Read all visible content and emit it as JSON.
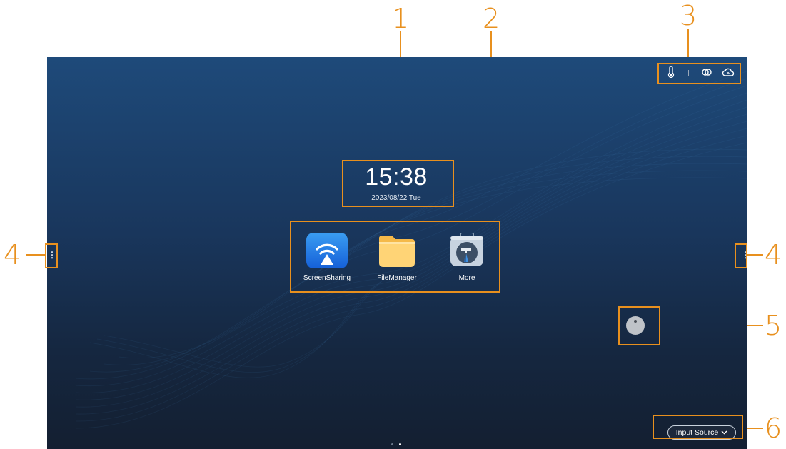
{
  "screen": {
    "clock": {
      "time": "15:38",
      "date": "2023/08/22 Tue"
    },
    "apps": [
      {
        "label": "ScreenSharing",
        "icon": "screen-sharing-icon"
      },
      {
        "label": "FileManager",
        "icon": "folder-icon"
      },
      {
        "label": "More",
        "icon": "toolbox-icon"
      }
    ],
    "status_bar": [
      "thermometer-icon",
      "link-icon",
      "cloud-icon"
    ],
    "input_source": {
      "label": "Input Source",
      "icon": "chevron-down-icon"
    },
    "page_indicator": {
      "count": 2,
      "active": 2
    }
  },
  "callouts": [
    "1",
    "2",
    "3",
    "4",
    "4",
    "5",
    "6"
  ],
  "colors": {
    "callout": "#e8901e",
    "background_top": "#1e4a7a",
    "background_bottom": "#141f31"
  }
}
